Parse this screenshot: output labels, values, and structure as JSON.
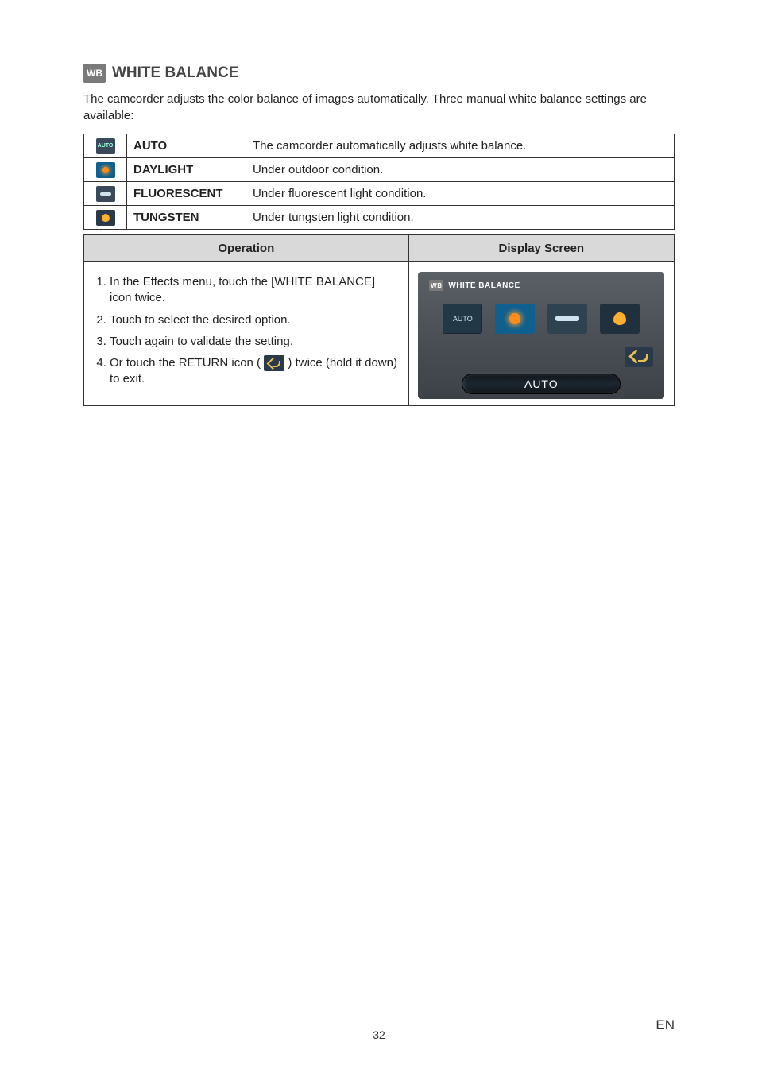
{
  "title": {
    "icon_label": "WB",
    "text": "WHITE BALANCE"
  },
  "intro": "The camcorder adjusts the color balance of images automatically. Three manual white balance settings are available:",
  "settings": [
    {
      "icon": "AUTO",
      "label": "AUTO",
      "desc": "The camcorder automatically adjusts white balance."
    },
    {
      "icon": "",
      "label": "DAYLIGHT",
      "desc": "Under outdoor condition."
    },
    {
      "icon": "",
      "label": "FLUORESCENT",
      "desc": "Under fluorescent light condition."
    },
    {
      "icon": "",
      "label": "TUNGSTEN",
      "desc": "Under tungsten light condition."
    }
  ],
  "op_table": {
    "header_left": "Operation",
    "header_right": "Display Screen",
    "steps": {
      "s1": "In the Effects menu, touch the [WHITE BALANCE] icon twice.",
      "s2": "Touch to select the desired option.",
      "s3": "Touch again to validate the setting.",
      "s4_a": "Or touch the RETURN icon (",
      "s4_b": ") twice (hold it down) to exit."
    }
  },
  "display": {
    "header_icon": "WB",
    "header_text": "WHITE BALANCE",
    "selected_label": "AUTO",
    "pill_text": "AUTO"
  },
  "footer": {
    "page_number": "32",
    "language": "EN"
  }
}
